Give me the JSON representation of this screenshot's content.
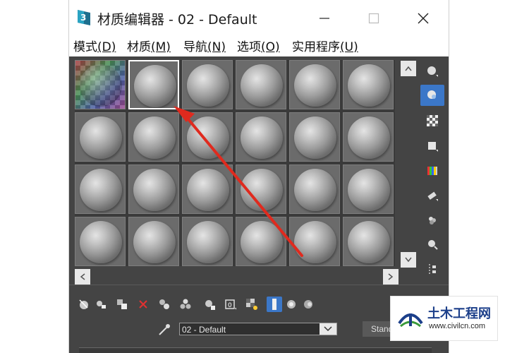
{
  "window": {
    "title": "材质编辑器 - 02 - Default",
    "controls": {
      "minimize": "minimize-icon",
      "maximize": "maximize-icon",
      "close": "close-icon"
    }
  },
  "menu": [
    {
      "label": "模式",
      "hotkey": "(D)"
    },
    {
      "label": "材质",
      "hotkey": "(M)"
    },
    {
      "label": "导航",
      "hotkey": "(N)"
    },
    {
      "label": "选项",
      "hotkey": "(O)"
    },
    {
      "label": "实用程序",
      "hotkey": "(U)"
    }
  ],
  "sample_slots": {
    "rows": 4,
    "cols": 6,
    "selected_index": 1,
    "checker_index": 0
  },
  "side_tools": [
    "sample-type-icon",
    "backlight-icon",
    "background-checker-icon",
    "sample-uv-tiling-icon",
    "video-color-check-icon",
    "make-preview-icon",
    "material-options-icon",
    "select-by-material-icon",
    "material-map-navigator-icon"
  ],
  "bottom_tools": [
    "get-material-icon",
    "put-to-scene-icon",
    "assign-material-icon",
    "reset-map-icon",
    "copy-material-icon",
    "make-unique-icon",
    "put-to-library-icon",
    "material-id-channel-icon",
    "show-shaded-material-icon",
    "show-end-result-icon",
    "go-to-parent-icon",
    "go-forward-sibling-icon"
  ],
  "material_name": {
    "value": "02 - Default"
  },
  "material_type_button": {
    "label": "Stand"
  },
  "accent_color": "#3b77c8",
  "watermark": {
    "cn": "土木工程网",
    "url": "www.civilcn.com"
  }
}
